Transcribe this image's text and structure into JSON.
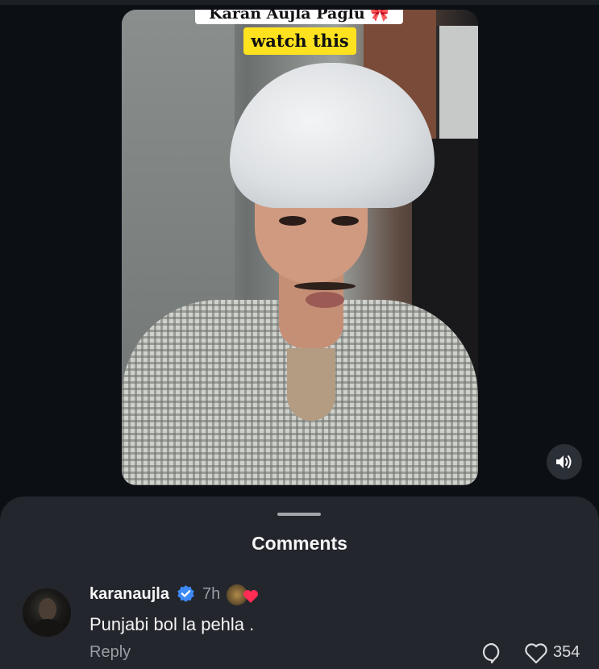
{
  "video": {
    "caption_top": "Karan Aujla Paglu 🎀",
    "caption_highlight": "watch this"
  },
  "comments_sheet": {
    "title": "Comments"
  },
  "comment": {
    "username": "karanaujla",
    "time": "7h",
    "text": "Punjabi bol la pehla .",
    "reply_label": "Reply",
    "like_count": "354"
  },
  "colors": {
    "background": "#0c0f14",
    "sheet": "#23262c",
    "verified": "#3d8af7",
    "highlight": "#ffe21f",
    "heart": "#ff2d55"
  },
  "icons": [
    "volume-icon",
    "verified-badge-icon",
    "heart-reaction-icon",
    "reply-icon",
    "like-heart-icon"
  ]
}
